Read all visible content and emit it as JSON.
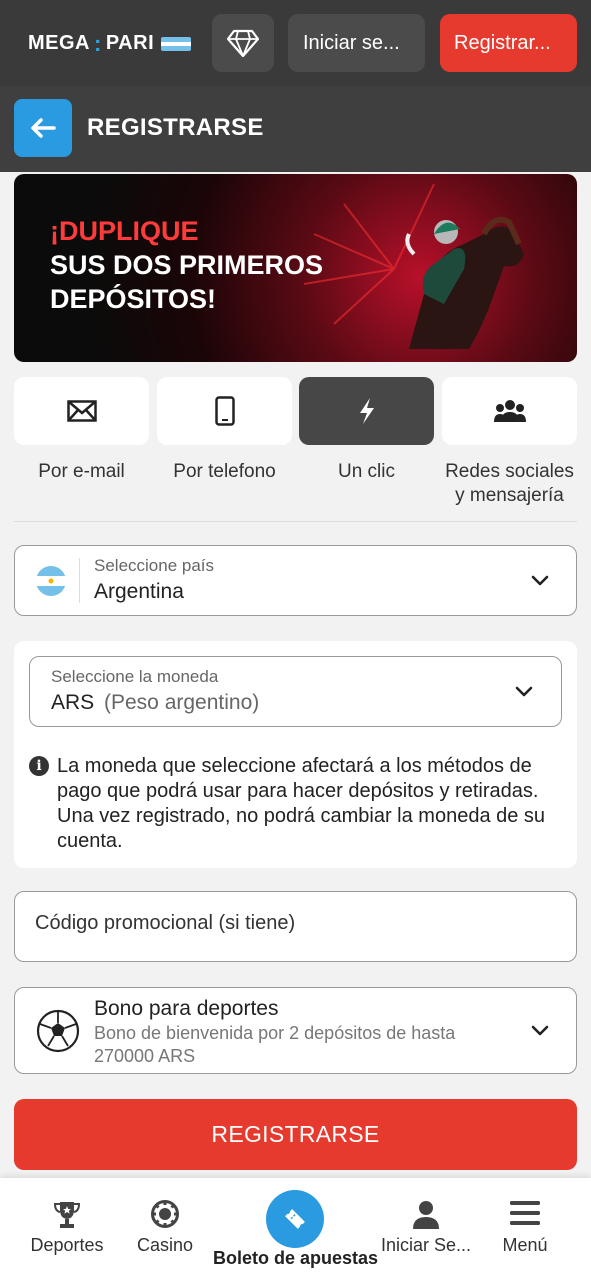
{
  "header": {
    "logo_left": "MEGA",
    "logo_dot": ":",
    "logo_right": "PARI",
    "login_label": "Iniciar se...",
    "register_label": "Registrar..."
  },
  "subheader": {
    "title": "REGISTRARSE"
  },
  "banner": {
    "line1": "¡DUPLIQUE",
    "line2": "SUS DOS PRIMEROS",
    "line3": "DEPÓSITOS!"
  },
  "tabs": [
    {
      "label": "Por e-mail",
      "icon": "envelope-icon",
      "active": false
    },
    {
      "label": "Por telefono",
      "icon": "phone-icon",
      "active": false
    },
    {
      "label": "Un clic",
      "icon": "lightning-icon",
      "active": true
    },
    {
      "label_line1": "Redes sociales",
      "label_line2": "y mensajería",
      "icon": "users-icon",
      "active": false
    }
  ],
  "country": {
    "caption": "Seleccione país",
    "value": "Argentina"
  },
  "currency": {
    "caption": "Seleccione la moneda",
    "code": "ARS",
    "name": "(Peso argentino)",
    "info": "La moneda que seleccione afectará a los métodos de pago que podrá usar para hacer depósitos y retiradas. Una vez registrado, no podrá cambiar la moneda de su cuenta."
  },
  "promo": {
    "placeholder": "Código promocional (si tiene)"
  },
  "bonus": {
    "title": "Bono para deportes",
    "description": "Bono de bienvenida por 2 depósitos de hasta 270000 ARS"
  },
  "register_button": "REGISTRARSE",
  "bottom_nav": {
    "deportes": "Deportes",
    "casino": "Casino",
    "boleto": "Boleto de apuestas",
    "login": "Iniciar Se...",
    "menu": "Menú"
  },
  "colors": {
    "accent_red": "#e63a2e",
    "accent_blue": "#2a9be0",
    "header_bg": "#3a3a3a"
  }
}
